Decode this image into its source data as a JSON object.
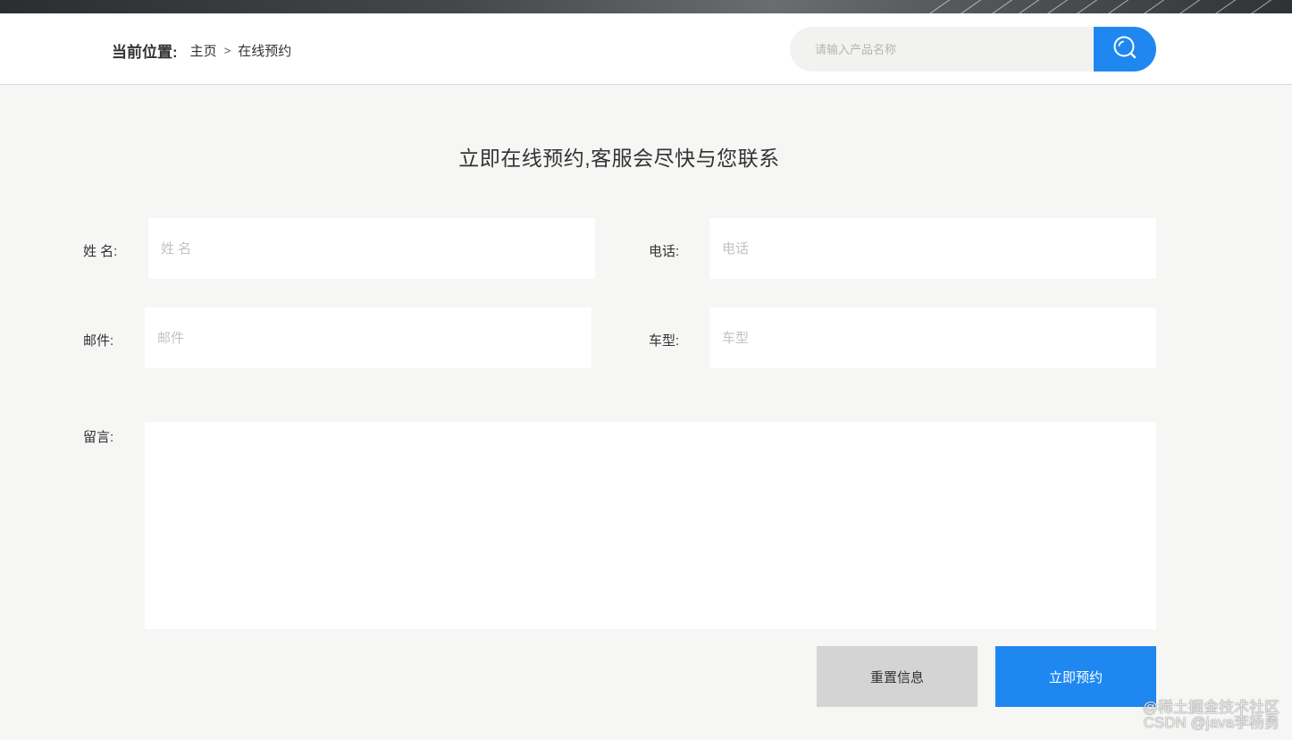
{
  "breadcrumb": {
    "label": "当前位置:",
    "home": "主页",
    "separator": ">",
    "current": "在线预约"
  },
  "search": {
    "placeholder": "请输入产品名称",
    "icon": "search-icon",
    "button_color": "#1f88f0"
  },
  "form": {
    "title": "立即在线预约,客服会尽快与您联系",
    "fields": {
      "name": {
        "label": "姓 名:",
        "placeholder": "姓 名",
        "value": ""
      },
      "phone": {
        "label": "电话:",
        "placeholder": "电话",
        "value": ""
      },
      "email": {
        "label": "邮件:",
        "placeholder": "邮件",
        "value": ""
      },
      "model": {
        "label": "车型:",
        "placeholder": "车型",
        "value": ""
      },
      "message": {
        "label": "留言:",
        "placeholder": "",
        "value": ""
      }
    },
    "buttons": {
      "reset": "重置信息",
      "submit": "立即预约"
    }
  },
  "watermark": {
    "line1": "@稀土掘金技术社区",
    "line2": "CSDN @java李杨勇"
  },
  "colors": {
    "accent": "#1f88f0",
    "background": "#f6f6f5",
    "reset_button": "#d4d4d4"
  }
}
